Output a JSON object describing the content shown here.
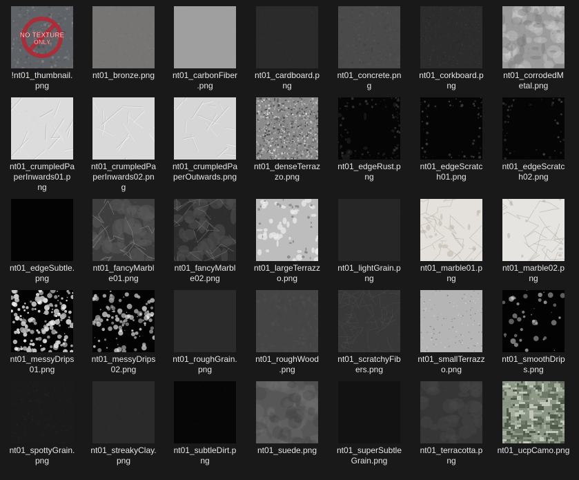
{
  "files": [
    {
      "name": "!nt01_thumbnail.png",
      "texture": "thumbnail-icon",
      "logo_text": [
        "NO TEXTURE",
        "ONLY"
      ]
    },
    {
      "name": "nt01_bronze.png",
      "texture": "bronze"
    },
    {
      "name": "nt01_carbonFiber.png",
      "texture": "carbonFiber"
    },
    {
      "name": "nt01_cardboard.png",
      "texture": "cardboard"
    },
    {
      "name": "nt01_concrete.png",
      "texture": "concrete"
    },
    {
      "name": "nt01_corkboard.png",
      "texture": "corkboard"
    },
    {
      "name": "nt01_corrodedMetal.png",
      "texture": "corrodedMetal"
    },
    {
      "name": "nt01_crumpledPaperInwards01.png",
      "texture": "crumpledPaperInwards01"
    },
    {
      "name": "nt01_crumpledPaperInwards02.png",
      "texture": "crumpledPaperInwards02"
    },
    {
      "name": "nt01_crumpledPaperOutwards.png",
      "texture": "crumpledPaperOutwards"
    },
    {
      "name": "nt01_denseTerrazzo.png",
      "texture": "denseTerrazzo"
    },
    {
      "name": "nt01_edgeRust.png",
      "texture": "edgeRust"
    },
    {
      "name": "nt01_edgeScratch01.png",
      "texture": "edgeScratch01"
    },
    {
      "name": "nt01_edgeScratch02.png",
      "texture": "edgeScratch02"
    },
    {
      "name": "nt01_edgeSubtle.png",
      "texture": "edgeSubtle"
    },
    {
      "name": "nt01_fancyMarble01.png",
      "texture": "fancyMarble01"
    },
    {
      "name": "nt01_fancyMarble02.png",
      "texture": "fancyMarble02"
    },
    {
      "name": "nt01_largeTerrazzo.png",
      "texture": "largeTerrazzo"
    },
    {
      "name": "nt01_lightGrain.png",
      "texture": "lightGrain"
    },
    {
      "name": "nt01_marble01.png",
      "texture": "marble01"
    },
    {
      "name": "nt01_marble02.png",
      "texture": "marble02"
    },
    {
      "name": "nt01_messyDrips01.png",
      "texture": "messyDrips01"
    },
    {
      "name": "nt01_messyDrips02.png",
      "texture": "messyDrips02"
    },
    {
      "name": "nt01_roughGrain.png",
      "texture": "roughGrain"
    },
    {
      "name": "nt01_roughWood.png",
      "texture": "roughWood"
    },
    {
      "name": "nt01_scratchyFibers.png",
      "texture": "scratchyFibers"
    },
    {
      "name": "nt01_smallTerrazzo.png",
      "texture": "smallTerrazzo"
    },
    {
      "name": "nt01_smoothDrips.png",
      "texture": "smoothDrips"
    },
    {
      "name": "nt01_spottyGrain.png",
      "texture": "spottyGrain"
    },
    {
      "name": "nt01_streakyClay.png",
      "texture": "streakyClay"
    },
    {
      "name": "nt01_subtleDirt.png",
      "texture": "subtleDirt"
    },
    {
      "name": "nt01_suede.png",
      "texture": "suede"
    },
    {
      "name": "nt01_superSubtleGrain.png",
      "texture": "superSubtleGrain"
    },
    {
      "name": "nt01_terracotta.png",
      "texture": "terracotta"
    },
    {
      "name": "nt01_ucpCamo.png",
      "texture": "ucpCamo"
    }
  ],
  "label_lines": [
    [
      "!nt01_thumbnail.",
      "png"
    ],
    [
      "nt01_bronze.png"
    ],
    [
      "nt01_carbonFiber",
      ".png"
    ],
    [
      "nt01_cardboard.p",
      "ng"
    ],
    [
      "nt01_concrete.pn",
      "g"
    ],
    [
      "nt01_corkboard.p",
      "ng"
    ],
    [
      "nt01_corrodedM",
      "etal.png"
    ],
    [
      "nt01_crumpledPa",
      "perInwards01.p",
      "ng"
    ],
    [
      "nt01_crumpledPa",
      "perInwards02.pn",
      "g"
    ],
    [
      "nt01_crumpledPa",
      "perOutwards.png"
    ],
    [
      "nt01_denseTerraz",
      "zo.png"
    ],
    [
      "nt01_edgeRust.p",
      "ng"
    ],
    [
      "nt01_edgeScratc",
      "h01.png"
    ],
    [
      "nt01_edgeScratc",
      "h02.png"
    ],
    [
      "nt01_edgeSubtle.",
      "png"
    ],
    [
      "nt01_fancyMarbl",
      "e01.png"
    ],
    [
      "nt01_fancyMarbl",
      "e02.png"
    ],
    [
      "nt01_largeTerrazz",
      "o.png"
    ],
    [
      "nt01_lightGrain.p",
      "ng"
    ],
    [
      "nt01_marble01.p",
      "ng"
    ],
    [
      "nt01_marble02.p",
      "ng"
    ],
    [
      "nt01_messyDrips",
      "01.png"
    ],
    [
      "nt01_messyDrips",
      "02.png"
    ],
    [
      "nt01_roughGrain.",
      "png"
    ],
    [
      "nt01_roughWood",
      ".png"
    ],
    [
      "nt01_scratchyFib",
      "ers.png"
    ],
    [
      "nt01_smallTerrazz",
      "o.png"
    ],
    [
      "nt01_smoothDrip",
      "s.png"
    ],
    [
      "nt01_spottyGrain.",
      "png"
    ],
    [
      "nt01_streakyClay.",
      "png"
    ],
    [
      "nt01_subtleDirt.p",
      "ng"
    ],
    [
      "nt01_suede.png"
    ],
    [
      "nt01_superSubtle",
      "Grain.png"
    ],
    [
      "nt01_terracotta.p",
      "ng"
    ],
    [
      "nt01_ucpCamo.png"
    ]
  ],
  "colors": {
    "background": "#191919",
    "label_text": "#e6e6e6",
    "no_texture_red": "#b02a35"
  }
}
